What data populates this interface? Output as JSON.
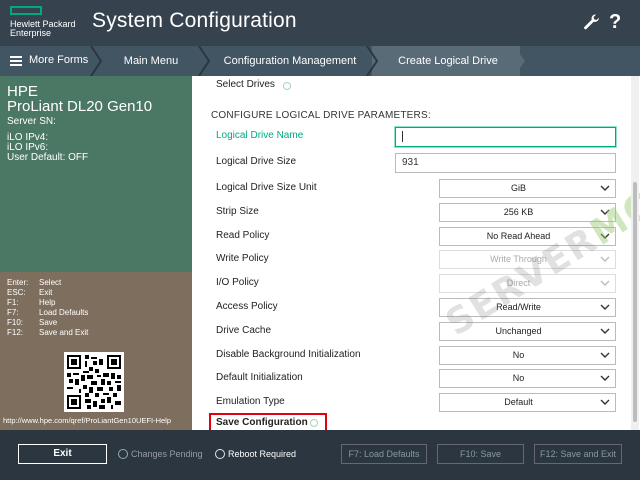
{
  "header": {
    "logo_line1": "Hewlett Packard",
    "logo_line2": "Enterprise",
    "title": "System Configuration"
  },
  "breadcrumb": {
    "more_forms": "More Forms",
    "items": [
      "Main Menu",
      "Configuration Management",
      "Create Logical Drive"
    ]
  },
  "server": {
    "vendor": "HPE",
    "model": "ProLiant DL20 Gen10",
    "serial": "Server SN:",
    "ilo_ipv4": "iLO IPv4:",
    "ilo_ipv6": "iLO IPv6:",
    "user_default": "User Default: OFF"
  },
  "keys": [
    {
      "key": "Enter:",
      "action": "Select"
    },
    {
      "key": "ESC:",
      "action": "Exit"
    },
    {
      "key": "F1:",
      "action": "Help"
    },
    {
      "key": "F7:",
      "action": "Load Defaults"
    },
    {
      "key": "F10:",
      "action": "Save"
    },
    {
      "key": "F12:",
      "action": "Save and Exit"
    }
  ],
  "help_url": "http://www.hpe.com/qref/ProLiantGen10UEFI-Help",
  "form": {
    "select_drives": "Select Drives",
    "section_title": "CONFIGURE LOGICAL DRIVE PARAMETERS:",
    "logical_drive_name": {
      "label": "Logical Drive Name",
      "value": ""
    },
    "logical_drive_size": {
      "label": "Logical Drive Size",
      "value": "931"
    },
    "rows": [
      {
        "label": "Logical Drive Size Unit",
        "value": "GiB",
        "disabled": false
      },
      {
        "label": "Strip Size",
        "value": "256 KB",
        "disabled": false
      },
      {
        "label": "Read Policy",
        "value": "No Read Ahead",
        "disabled": false
      },
      {
        "label": "Write Policy",
        "value": "Write Through",
        "disabled": true
      },
      {
        "label": "I/O Policy",
        "value": "Direct",
        "disabled": true
      },
      {
        "label": "Access Policy",
        "value": "Read/Write",
        "disabled": false
      },
      {
        "label": "Drive Cache",
        "value": "Unchanged",
        "disabled": false
      },
      {
        "label": "Disable Background Initialization",
        "value": "No",
        "disabled": false
      },
      {
        "label": "Default Initialization",
        "value": "No",
        "disabled": false
      },
      {
        "label": "Emulation Type",
        "value": "Default",
        "disabled": false
      }
    ],
    "save_configuration": "Save Configuration"
  },
  "watermark": {
    "part1": "SERVER",
    "part2": "MON"
  },
  "footer": {
    "exit": "Exit",
    "changes_pending": "Changes Pending",
    "reboot_required": "Reboot Required",
    "f7": "F7: Load Defaults",
    "f10": "F10: Save",
    "f12": "F12: Save and Exit"
  },
  "colors": {
    "accent_green": "#01a982",
    "highlight_red": "#e0000f",
    "server_panel": "#4b7865",
    "keys_panel": "#7e6e5e"
  }
}
